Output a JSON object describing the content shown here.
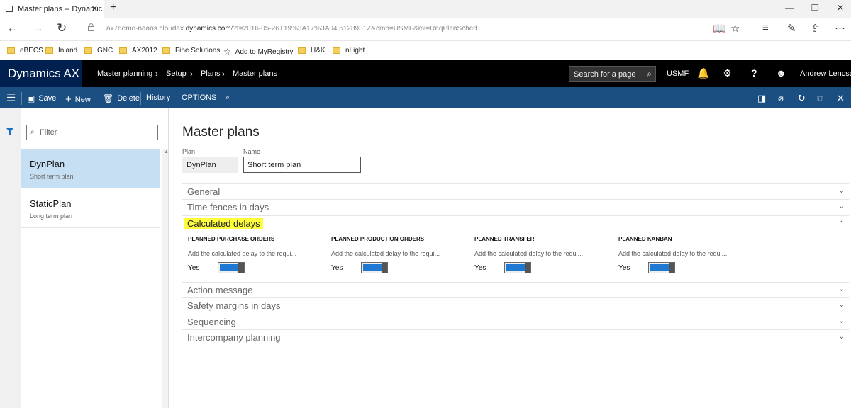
{
  "browser": {
    "tab_title": "Master plans -- Dynamic",
    "url_prefix": "ax7demo-naaos.cloudax.",
    "url_domain": "dynamics.com",
    "url_rest": "/?t=2016-05-26T19%3A17%3A04.5128931Z&cmp=USMF&mi=ReqPlanSched",
    "favorites": [
      "eBECS",
      "Inland",
      "GNC",
      "AX2012",
      "Fine Solutions",
      "Add to MyRegistry",
      "H&K",
      "nLight"
    ]
  },
  "topbar": {
    "brand": "Dynamics AX",
    "breadcrumb": [
      "Master planning",
      "Setup",
      "Plans",
      "Master plans"
    ],
    "search_placeholder": "Search for a page",
    "company": "USMF",
    "user": "Andrew Lencsak"
  },
  "actions": {
    "save": "Save",
    "new": "New",
    "delete": "Delete",
    "history": "History",
    "options": "OPTIONS"
  },
  "list": {
    "filter_placeholder": "Filter",
    "items": [
      {
        "title": "DynPlan",
        "subtitle": "Short term plan"
      },
      {
        "title": "StaticPlan",
        "subtitle": "Long term plan"
      }
    ]
  },
  "form": {
    "title": "Master plans",
    "plan_label": "Plan",
    "plan_value": "DynPlan",
    "name_label": "Name",
    "name_value": "Short term plan",
    "fasttabs_top": [
      "General",
      "Time fences in days"
    ],
    "calc_delays_title": "Calculated delays",
    "columns": [
      {
        "heading": "PLANNED PURCHASE ORDERS",
        "desc": "Add the calculated delay to the requi...",
        "value": "Yes",
        "on": true
      },
      {
        "heading": "PLANNED PRODUCTION ORDERS",
        "desc": "Add the calculated delay to the requi...",
        "value": "Yes",
        "on": true
      },
      {
        "heading": "PLANNED TRANSFER",
        "desc": "Add the calculated delay to the requi...",
        "value": "Yes",
        "on": true
      },
      {
        "heading": "PLANNED KANBAN",
        "desc": "Add the calculated delay to the requi...",
        "value": "Yes",
        "on": true
      }
    ],
    "fasttabs_bottom": [
      "Action message",
      "Safety margins in days",
      "Sequencing",
      "Intercompany planning"
    ]
  },
  "colors": {
    "brand_bg": "#002050",
    "action_bg": "#1b4f82",
    "toggle_on": "#1f78d1",
    "highlight": "#ffff3c"
  }
}
